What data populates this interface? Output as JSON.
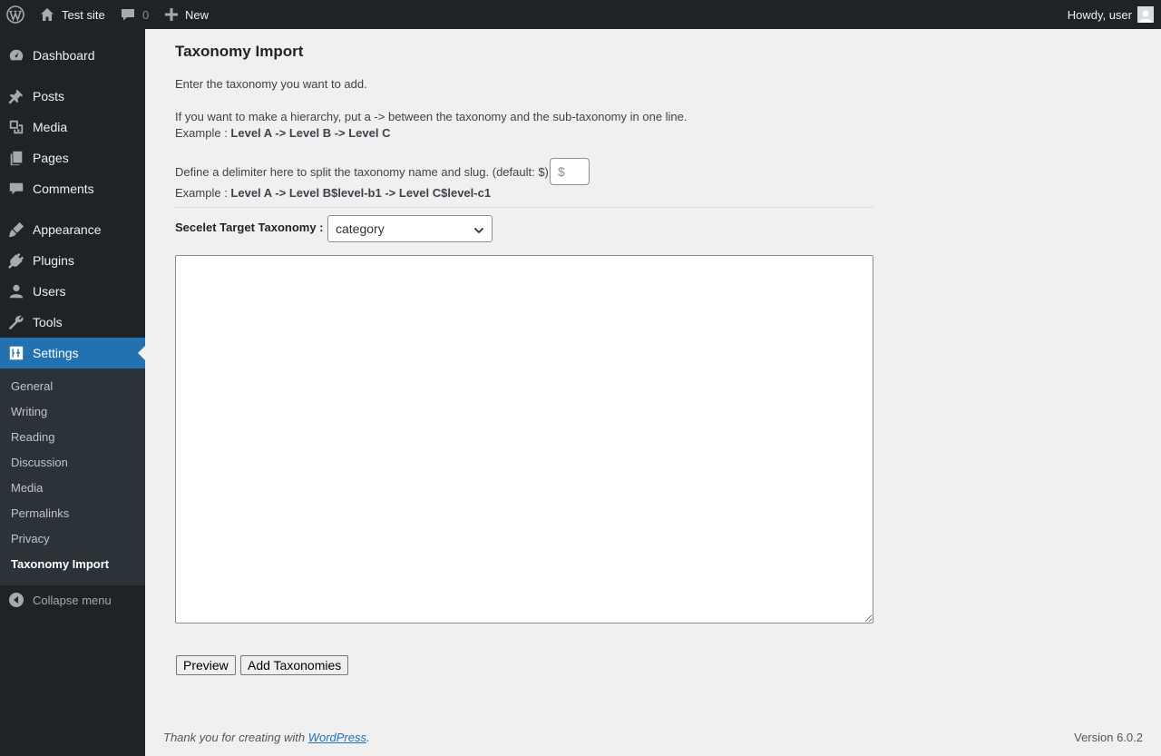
{
  "adminbar": {
    "site_name": "Test site",
    "comments_count": "0",
    "new_label": "New",
    "greeting": "Howdy, user"
  },
  "sidebar": {
    "items": [
      {
        "label": "Dashboard",
        "icon": "dashboard-icon"
      },
      {
        "label": "Posts",
        "icon": "pin-icon"
      },
      {
        "label": "Media",
        "icon": "media-icon"
      },
      {
        "label": "Pages",
        "icon": "pages-icon"
      },
      {
        "label": "Comments",
        "icon": "comments-icon"
      },
      {
        "label": "Appearance",
        "icon": "brush-icon"
      },
      {
        "label": "Plugins",
        "icon": "plug-icon"
      },
      {
        "label": "Users",
        "icon": "user-icon"
      },
      {
        "label": "Tools",
        "icon": "wrench-icon"
      },
      {
        "label": "Settings",
        "icon": "settings-icon"
      }
    ],
    "submenu": [
      "General",
      "Writing",
      "Reading",
      "Discussion",
      "Media",
      "Permalinks",
      "Privacy",
      "Taxonomy Import"
    ],
    "collapse_label": "Collapse menu"
  },
  "main": {
    "title": "Taxonomy Import",
    "intro": "Enter the taxonomy you want to add.",
    "hierarchy_text": "If you want to make a hierarchy, put a -> between the taxonomy and the sub-taxonomy in one line.",
    "example_prefix": "Example : ",
    "example1": "Level A -> Level B -> Level C",
    "delimiter_text": "Define a delimiter here to split the taxonomy name and slug. (default: $)",
    "delimiter_placeholder": "$",
    "example2": "Level A -> Level B$level-b1 -> Level C$level-c1",
    "target_label": "Secelet Target Taxonomy :",
    "target_value": "category",
    "textarea_value": "",
    "preview_button": "Preview",
    "add_button": "Add Taxonomies"
  },
  "footer": {
    "thanks_prefix": "Thank you for creating with ",
    "wordpress_link": "WordPress",
    "thanks_suffix": ".",
    "version": "Version 6.0.2"
  },
  "colors": {
    "adminbar_bg": "#1d2327",
    "accent": "#2271b1",
    "submenu_bg": "#2c3338",
    "page_bg": "#f0f0f1"
  }
}
